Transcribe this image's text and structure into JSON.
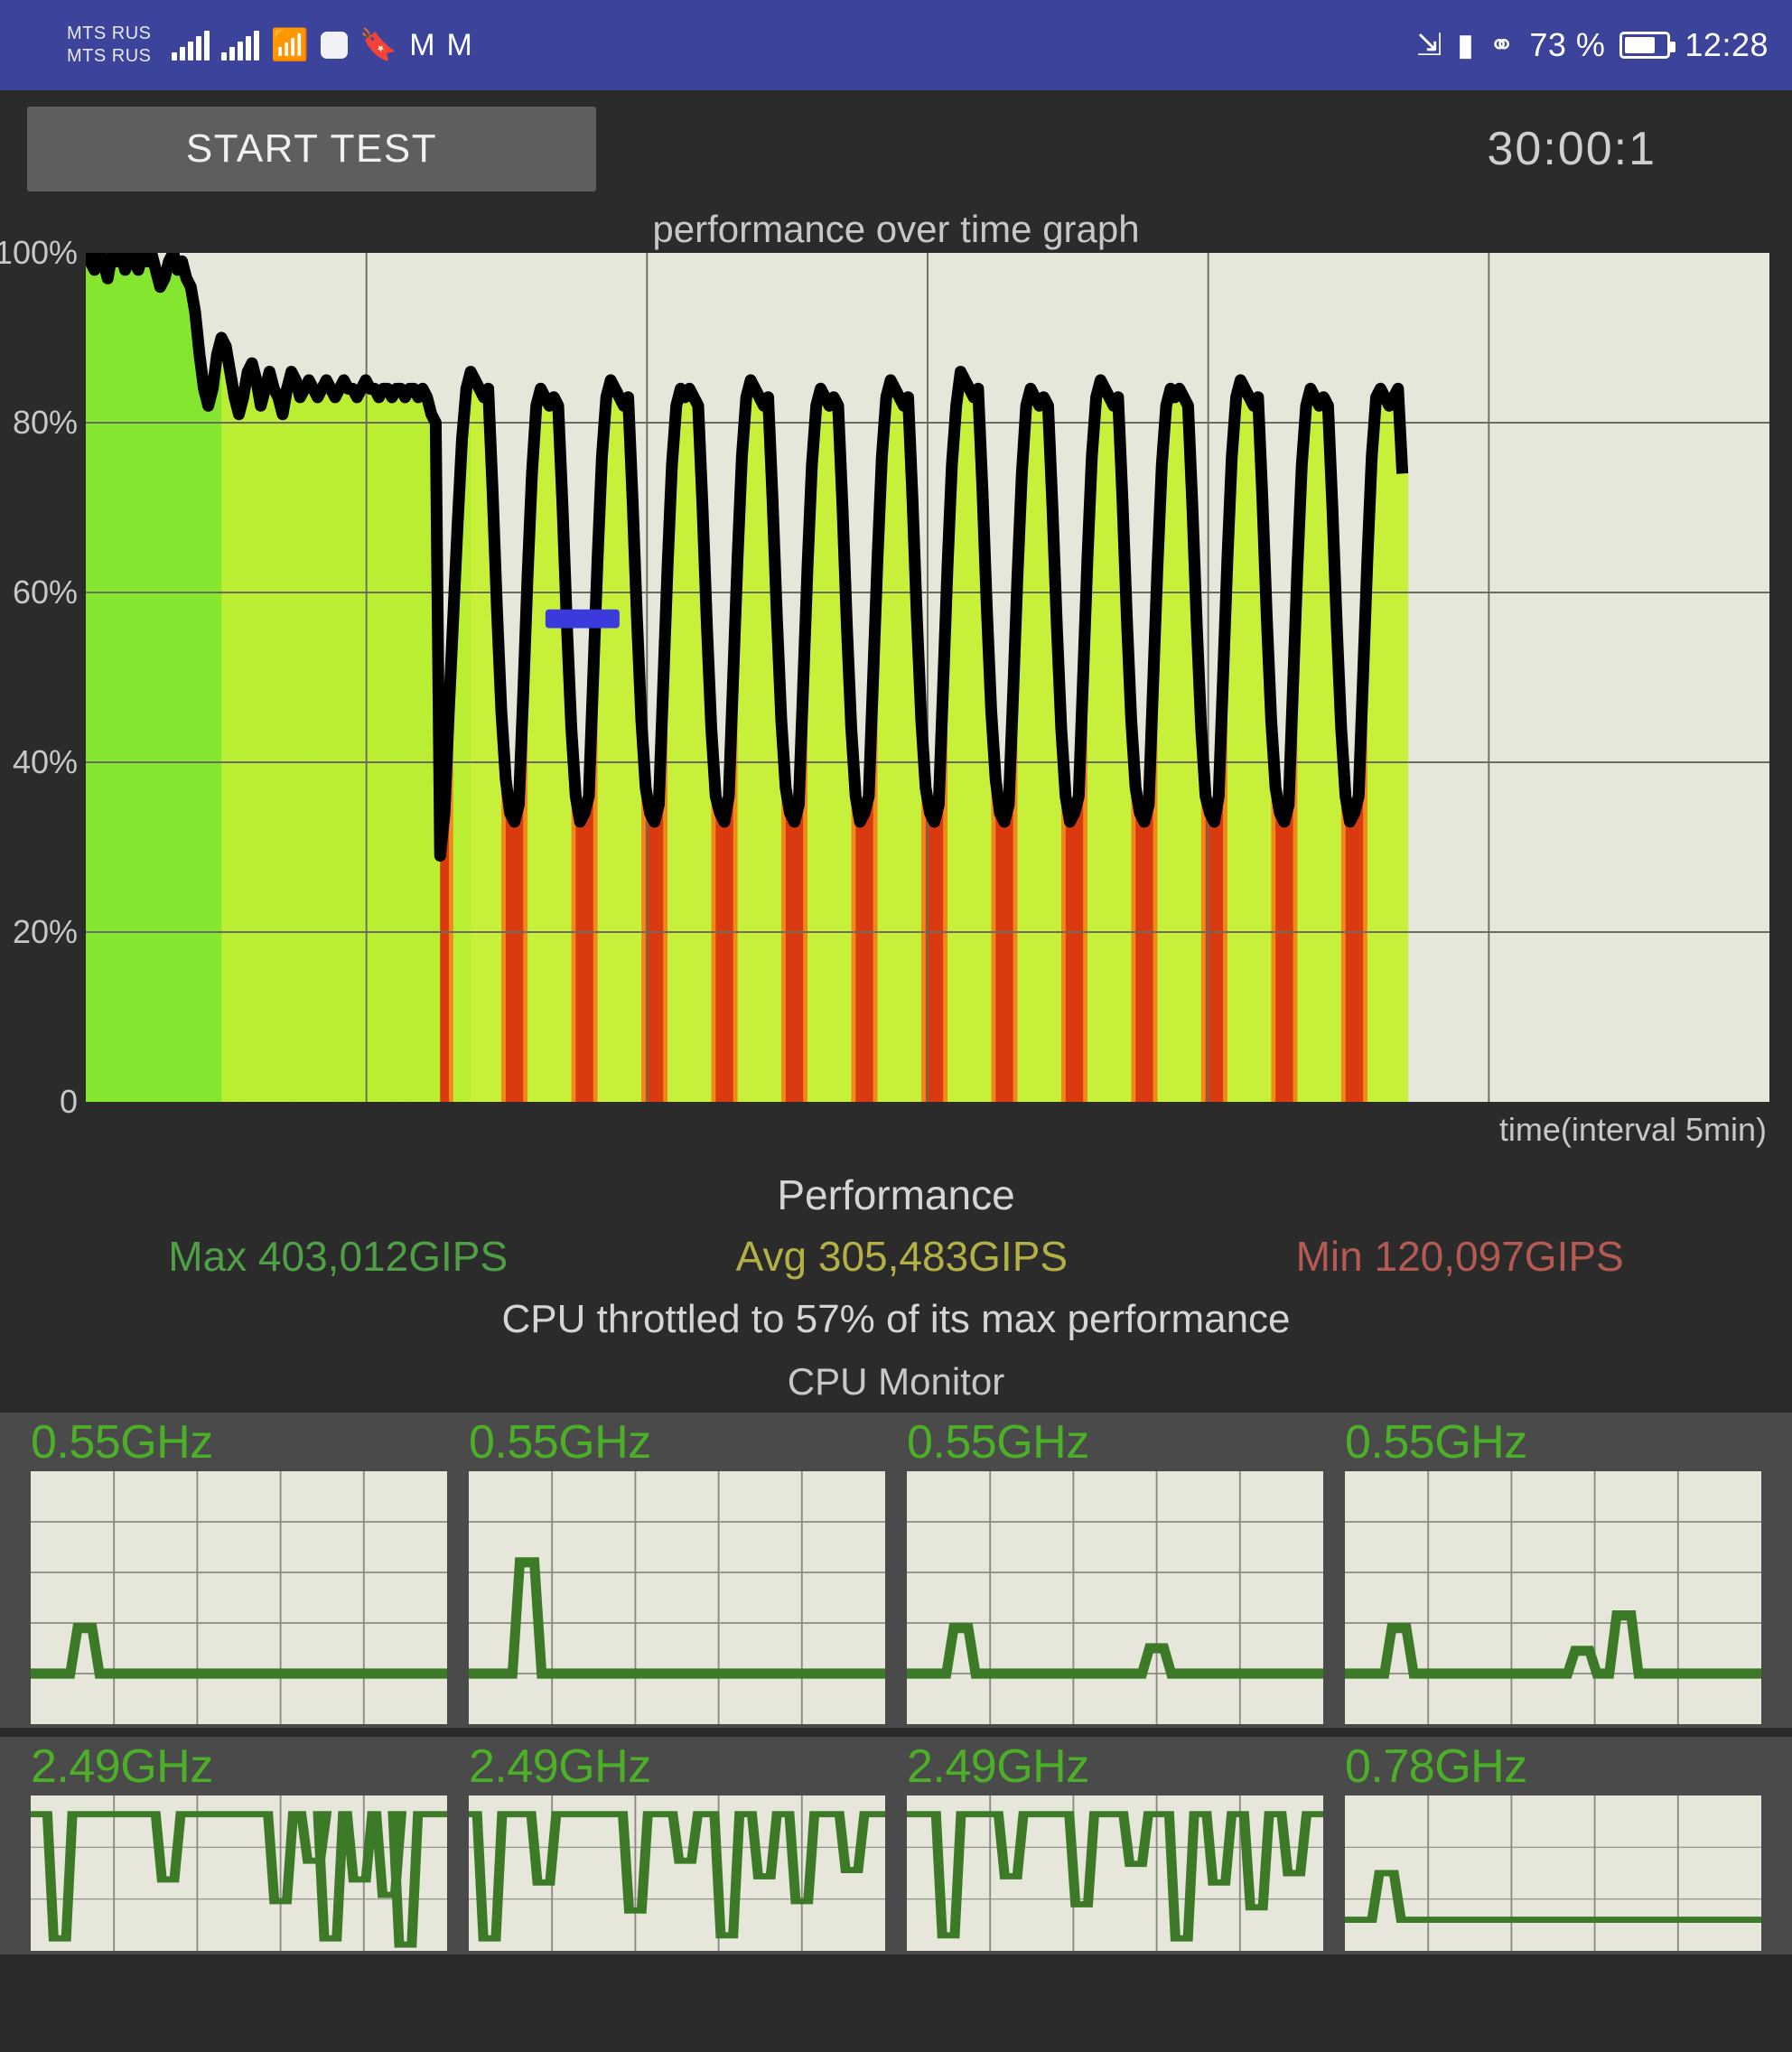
{
  "statusbar": {
    "carrier_line1": "MTS RUS",
    "carrier_line2": "MTS RUS",
    "icons": [
      "signal-bars-icon",
      "signal-bars-icon",
      "wifi-icon",
      "rounded-square-icon",
      "bookmark-icon",
      "m-logo-icon",
      "m-logo-icon"
    ],
    "right_icons": [
      "bluetooth-icon",
      "vibrate-icon",
      "speedometer-icon"
    ],
    "battery_percent": "73 %",
    "clock": "12:28",
    "bg_color": "#3b439b"
  },
  "toolbar": {
    "start_label": "START TEST",
    "timer": "30:00:1"
  },
  "performance": {
    "section_title": "Performance",
    "max_label": "Max 403,012GIPS",
    "avg_label": "Avg 305,483GIPS",
    "min_label": "Min 120,097GIPS",
    "max_color": "#4f9f47",
    "avg_color": "#b3b145",
    "min_color": "#b45a52",
    "throttle_text": "CPU throttled to 57% of its max performance"
  },
  "cpu_monitor": {
    "title": "CPU Monitor",
    "cores": [
      {
        "freq": "0.55GHz"
      },
      {
        "freq": "0.55GHz"
      },
      {
        "freq": "0.55GHz"
      },
      {
        "freq": "0.55GHz"
      },
      {
        "freq": "2.49GHz"
      },
      {
        "freq": "2.49GHz"
      },
      {
        "freq": "2.49GHz"
      },
      {
        "freq": "0.78GHz"
      }
    ],
    "freq_color": "#4caf28"
  },
  "chart_data": {
    "type": "area",
    "title": "performance over time graph",
    "xlabel": "time(interval 5min)",
    "ylabel": "",
    "ytick_labels": [
      "100%",
      "80%",
      "60%",
      "40%",
      "20%",
      "0"
    ],
    "ytick_values": [
      100,
      80,
      60,
      40,
      20,
      0
    ],
    "ylim": [
      0,
      100
    ],
    "grid": true,
    "vertical_gridlines": 6,
    "marker": {
      "name": "throttle-marker",
      "value": 57,
      "color": "#3b3bdd",
      "x_fraction": 0.295
    },
    "plot_bg": "#e6e6db",
    "line_color": "#000000",
    "fill_colors": {
      "high": "#9ae52e",
      "mid": "#c8f03a",
      "low": "#d93a10"
    },
    "values": [
      100,
      99,
      98,
      100,
      99,
      97,
      100,
      99,
      100,
      98,
      100,
      99,
      98,
      100,
      99,
      100,
      98,
      96,
      97,
      99,
      100,
      98,
      99,
      97,
      96,
      93,
      88,
      84,
      82,
      84,
      88,
      90,
      89,
      86,
      83,
      81,
      83,
      86,
      87,
      85,
      82,
      84,
      86,
      84,
      83,
      81,
      84,
      86,
      85,
      83,
      84,
      85,
      84,
      83,
      84,
      85,
      84,
      83,
      84,
      85,
      84,
      84,
      83,
      84,
      85,
      84,
      84,
      83,
      84,
      84,
      83,
      84,
      84,
      83,
      84,
      84,
      83,
      84,
      83,
      81,
      80,
      29,
      34,
      46,
      57,
      68,
      78,
      84,
      86,
      85,
      84,
      83,
      84,
      72,
      58,
      46,
      38,
      34,
      33,
      35,
      48,
      62,
      74,
      82,
      84,
      83,
      82,
      83,
      82,
      70,
      56,
      44,
      36,
      33,
      34,
      36,
      50,
      64,
      76,
      83,
      85,
      84,
      83,
      82,
      83,
      71,
      57,
      45,
      37,
      34,
      33,
      35,
      49,
      63,
      75,
      82,
      84,
      83,
      84,
      83,
      82,
      70,
      56,
      44,
      36,
      34,
      33,
      36,
      50,
      64,
      76,
      83,
      85,
      84,
      83,
      82,
      83,
      71,
      57,
      45,
      37,
      34,
      33,
      35,
      49,
      63,
      75,
      82,
      84,
      83,
      82,
      83,
      82,
      70,
      56,
      44,
      36,
      33,
      34,
      36,
      50,
      64,
      76,
      83,
      85,
      84,
      83,
      82,
      83,
      71,
      57,
      45,
      37,
      34,
      33,
      35,
      49,
      63,
      75,
      82,
      86,
      85,
      84,
      83,
      84,
      72,
      58,
      46,
      38,
      34,
      33,
      35,
      48,
      62,
      74,
      82,
      84,
      83,
      82,
      83,
      82,
      70,
      56,
      44,
      36,
      33,
      34,
      36,
      50,
      64,
      76,
      83,
      85,
      84,
      83,
      82,
      83,
      71,
      57,
      45,
      37,
      34,
      33,
      35,
      49,
      63,
      75,
      82,
      84,
      83,
      84,
      83,
      82,
      70,
      56,
      44,
      36,
      34,
      33,
      36,
      50,
      64,
      76,
      83,
      85,
      84,
      83,
      82,
      83,
      71,
      57,
      45,
      37,
      34,
      33,
      35,
      49,
      63,
      75,
      82,
      84,
      83,
      82,
      83,
      82,
      70,
      56,
      44,
      36,
      33,
      34,
      36,
      50,
      64,
      76,
      83,
      84,
      83,
      82,
      83,
      84,
      74
    ],
    "data_end_fraction": 0.782,
    "summary": {
      "max_pct": 100,
      "min_pct": 29,
      "throttled_to_pct": 57
    }
  },
  "cpu_charts": [
    {
      "name": "core-1",
      "baseline": 20,
      "spikes": [
        {
          "x": 0.13,
          "h": 18
        }
      ],
      "plot_bg": "#e6e6db",
      "line_color": "#3c7a28",
      "grid_rows": 5,
      "grid_cols": 5
    },
    {
      "name": "core-2",
      "baseline": 20,
      "spikes": [
        {
          "x": 0.14,
          "h": 44
        }
      ],
      "plot_bg": "#e6e6db",
      "line_color": "#3c7a28",
      "grid_rows": 5,
      "grid_cols": 5
    },
    {
      "name": "core-3",
      "baseline": 20,
      "spikes": [
        {
          "x": 0.13,
          "h": 18
        },
        {
          "x": 0.6,
          "h": 10
        }
      ],
      "plot_bg": "#e6e6db",
      "line_color": "#3c7a28",
      "grid_rows": 5,
      "grid_cols": 5
    },
    {
      "name": "core-4",
      "baseline": 20,
      "spikes": [
        {
          "x": 0.13,
          "h": 18
        },
        {
          "x": 0.57,
          "h": 9
        },
        {
          "x": 0.67,
          "h": 23
        }
      ],
      "plot_bg": "#e6e6db",
      "line_color": "#3c7a28",
      "grid_rows": 5,
      "grid_cols": 5
    },
    {
      "name": "core-5",
      "baseline": 88,
      "dips": [
        {
          "x": 0.07,
          "d": 80
        },
        {
          "x": 0.33,
          "d": 42
        },
        {
          "x": 0.6,
          "d": 56
        },
        {
          "x": 0.68,
          "d": 30
        },
        {
          "x": 0.72,
          "d": 80
        },
        {
          "x": 0.79,
          "d": 42
        },
        {
          "x": 0.86,
          "d": 52
        },
        {
          "x": 0.9,
          "d": 84
        }
      ],
      "plot_bg": "#e6e6db",
      "line_color": "#3c7a28",
      "grid_rows": 3,
      "grid_cols": 5
    },
    {
      "name": "core-6",
      "baseline": 88,
      "dips": [
        {
          "x": 0.05,
          "d": 80
        },
        {
          "x": 0.18,
          "d": 44
        },
        {
          "x": 0.4,
          "d": 62
        },
        {
          "x": 0.52,
          "d": 30
        },
        {
          "x": 0.62,
          "d": 78
        },
        {
          "x": 0.71,
          "d": 40
        },
        {
          "x": 0.8,
          "d": 56
        },
        {
          "x": 0.92,
          "d": 36
        }
      ],
      "plot_bg": "#e6e6db",
      "line_color": "#3c7a28",
      "grid_rows": 3,
      "grid_cols": 5
    },
    {
      "name": "core-7",
      "baseline": 88,
      "dips": [
        {
          "x": 0.1,
          "d": 78
        },
        {
          "x": 0.25,
          "d": 40
        },
        {
          "x": 0.42,
          "d": 58
        },
        {
          "x": 0.55,
          "d": 32
        },
        {
          "x": 0.66,
          "d": 80
        },
        {
          "x": 0.75,
          "d": 44
        },
        {
          "x": 0.84,
          "d": 60
        },
        {
          "x": 0.93,
          "d": 38
        }
      ],
      "plot_bg": "#e6e6db",
      "line_color": "#3c7a28",
      "grid_rows": 3,
      "grid_cols": 5
    },
    {
      "name": "core-8",
      "baseline": 20,
      "spikes": [
        {
          "x": 0.1,
          "h": 30
        }
      ],
      "plot_bg": "#e6e6db",
      "line_color": "#3c7a28",
      "grid_rows": 3,
      "grid_cols": 5
    }
  ]
}
